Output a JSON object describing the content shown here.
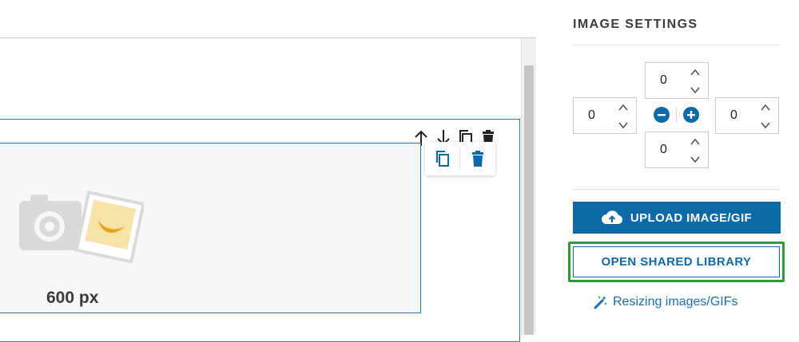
{
  "editor": {
    "image_size_label": "600 px",
    "block_toolbar_icons": [
      "move-up-icon",
      "move-down-icon",
      "duplicate-icon",
      "delete-icon"
    ],
    "image_toolbar_icons": [
      "duplicate-icon",
      "delete-icon"
    ],
    "placeholder_icon": "camera-and-photo-placeholder-icon"
  },
  "settings": {
    "title": "IMAGE SETTINGS",
    "padding": {
      "top": "0",
      "left": "0",
      "right": "0",
      "bottom": "0"
    },
    "padding_controls": [
      "minus-icon",
      "plus-icon"
    ],
    "upload_label": "UPLOAD IMAGE/GIF",
    "upload_icon": "cloud-upload-icon",
    "shared_library_label": "OPEN SHARED LIBRARY",
    "help_link_label": "Resizing images/GIFs",
    "help_link_icon": "magic-wand-icon"
  },
  "colors": {
    "primary": "#0e6aa7",
    "selection_border": "#2a7ab8",
    "focus_ring": "#2e9a3a"
  }
}
